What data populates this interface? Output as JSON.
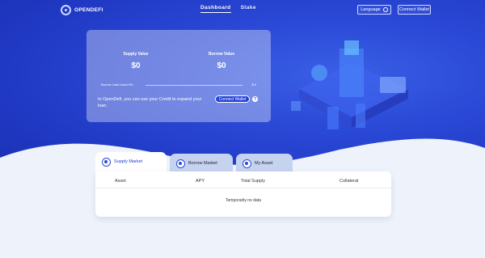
{
  "header": {
    "logo_text": "OPENDEFI",
    "nav": [
      {
        "label": "Dashboard",
        "active": true
      },
      {
        "label": "Stake",
        "active": false
      }
    ],
    "language_label": "Language",
    "connect_label": "Connect Wallet"
  },
  "summary": {
    "supply_label": "Supply Value",
    "supply_value": "$0",
    "borrow_label": "Borrow Value",
    "borrow_value": "$0",
    "limit_label": "Borrow Limit Used 0%",
    "limit_fraction": 0,
    "limit_value": "$ 0",
    "description": "In OpenDefi, you can use your Credit to expand your loan.",
    "connect_label": "Connect Wallet",
    "help_symbol": "?"
  },
  "tabs": [
    {
      "label": "Supply Market",
      "icon": "coin-stack-icon",
      "active": true
    },
    {
      "label": "Borrow Market",
      "icon": "wallet-icon",
      "active": false
    },
    {
      "label": "My Asset",
      "icon": "wallet-icon",
      "active": false
    }
  ],
  "table": {
    "columns": [
      "Asset",
      "APY",
      "Total Supply",
      "Collateral"
    ],
    "empty_text": "Temporarily no data"
  },
  "colors": {
    "hero": "#2a49d6",
    "accent": "#1f40d6",
    "page_bg": "#eef3fb"
  }
}
